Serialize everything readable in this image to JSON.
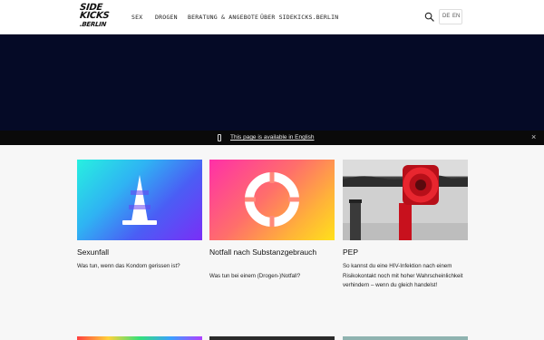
{
  "header": {
    "logo_line1": "SIDE",
    "logo_line2": "KICKS",
    "logo_line3": ".BERLIN",
    "nav": [
      "SEX",
      "DROGEN",
      "BERATUNG & ANGEBOTE",
      "ÜBER SIDEKICKS.BERLIN"
    ],
    "lang_de": "DE",
    "lang_en": "EN",
    "search_icon": "search-icon"
  },
  "language_bar": {
    "message": "This page is available in English",
    "icon": "phone-icon",
    "close_icon": "close-icon",
    "close_glyph": "×"
  },
  "cards": [
    {
      "title": "Sexunfall",
      "description": "Was tun, wenn das Kondom gerissen ist?",
      "image": "traffic-cone-icon"
    },
    {
      "title": "Notfall nach Substanzgebrauch",
      "description": "Was tun bei einem (Drogen-)Notfall?",
      "image": "lifebuoy-icon"
    },
    {
      "title": "PEP",
      "description": "So kannst du eine HIV-Infektion nach einem Risikokontakt noch mit hoher Wahrscheinlichkeit verhindern – wenn du gleich handelst!",
      "image": "lifebuoy-photo"
    }
  ],
  "colors": {
    "hero_bg": "#050a26",
    "language_bar_bg": "#0a0a0a",
    "page_bg": "#f7f7f7"
  }
}
